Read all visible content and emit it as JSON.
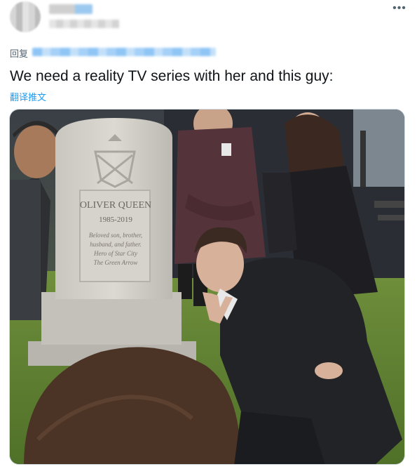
{
  "author": {
    "avatar_icon": "avatar",
    "name_redacted": true,
    "handle_redacted": true
  },
  "menu": {
    "more_icon": "more-horizontal-icon",
    "glyph": "•••"
  },
  "reply": {
    "label": "回复",
    "target_redacted": true
  },
  "tweet": {
    "text": "We need a reality TV series with her and this guy:",
    "translate_label": "翻译推文"
  },
  "media": {
    "description_icon": "photo",
    "headstone": {
      "name": "OLIVER QUEEN",
      "years": "1985-2019",
      "epitaph": [
        "Beloved son, brother,",
        "husband, and father.",
        "Hero of Star City",
        "The Green Arrow"
      ]
    }
  },
  "colors": {
    "link": "#1d9bf0",
    "text": "#0f1419",
    "muted": "#536471"
  }
}
